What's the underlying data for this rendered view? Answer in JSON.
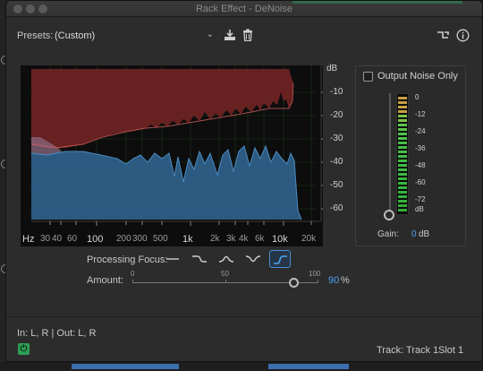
{
  "window": {
    "title": "Rack Effect - DeNoise"
  },
  "presets": {
    "label": "Presets:",
    "value": "(Custom)"
  },
  "graph": {
    "y_unit": "dB",
    "y_ticks": [
      "-10",
      "-20",
      "-30",
      "-40",
      "-50",
      "-60"
    ],
    "x_unit": "Hz",
    "x_ticks_minor": [
      "30",
      "40",
      "60",
      "200",
      "300",
      "500",
      "2k",
      "3k",
      "4k",
      "6k",
      "20k"
    ],
    "x_ticks_major": [
      "100",
      "1k",
      "10k"
    ],
    "colors": {
      "noise_red": "#7a2626",
      "signal_blue": "#2e5f88",
      "grid": "#1f3a1f",
      "pink_band": "#8a6a80"
    }
  },
  "output_noise": {
    "label": "Output Noise Only",
    "checked": false
  },
  "meter": {
    "scale": [
      "0",
      "-12",
      "-24",
      "-36",
      "-48",
      "-60",
      "-72"
    ],
    "scale_unit": "dB",
    "gain_label": "Gain:",
    "gain_value": "0",
    "gain_unit": "dB"
  },
  "processing_focus": {
    "label": "Processing Focus:",
    "options": [
      "all-frequencies",
      "low-frequencies",
      "mid-frequencies",
      "high-and-low",
      "high-frequencies"
    ],
    "selected": "high-frequencies"
  },
  "amount": {
    "label": "Amount:",
    "scale": [
      "0",
      "50",
      "100"
    ],
    "value": "90",
    "unit": "%",
    "fraction": 0.9
  },
  "footer": {
    "io": "In: L, R | Out: L, R",
    "track": "Track: Track 1",
    "slot": "Slot 1"
  }
}
